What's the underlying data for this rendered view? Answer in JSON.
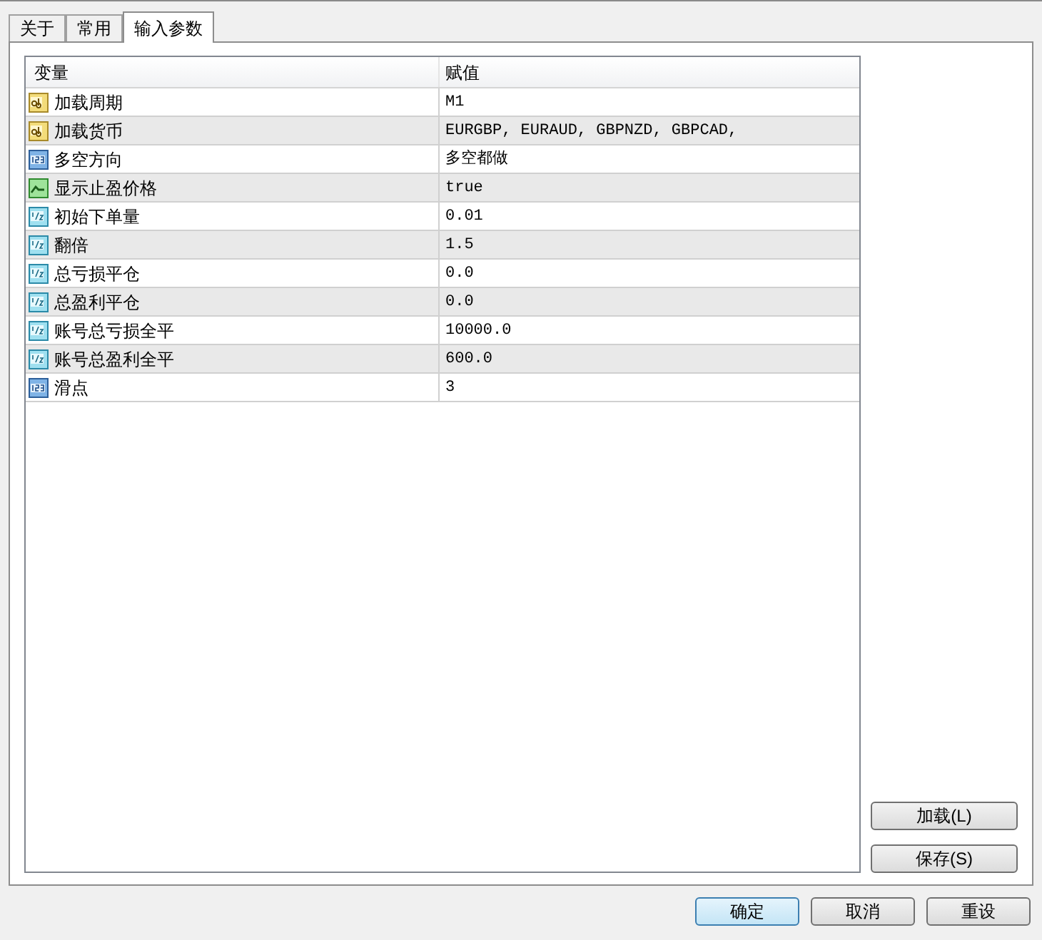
{
  "tabs": [
    {
      "label": "关于",
      "selected": false
    },
    {
      "label": "常用",
      "selected": false
    },
    {
      "label": "输入参数",
      "selected": true
    }
  ],
  "table": {
    "columns": [
      "变量",
      "赋值"
    ],
    "rows": [
      {
        "kind": "string",
        "name": "加载周期",
        "value": "M1"
      },
      {
        "kind": "string",
        "name": "加载货币",
        "value": "EURGBP, EURAUD, GBPNZD, GBPCAD,"
      },
      {
        "kind": "int",
        "name": "多空方向",
        "value": "多空都做"
      },
      {
        "kind": "bool",
        "name": "显示止盈价格",
        "value": "true"
      },
      {
        "kind": "double",
        "name": "初始下单量",
        "value": "0.01"
      },
      {
        "kind": "double",
        "name": "翻倍",
        "value": "1.5"
      },
      {
        "kind": "double",
        "name": "总亏损平仓",
        "value": "0.0"
      },
      {
        "kind": "double",
        "name": "总盈利平仓",
        "value": "0.0"
      },
      {
        "kind": "double",
        "name": "账号总亏损全平",
        "value": "10000.0"
      },
      {
        "kind": "double",
        "name": "账号总盈利全平",
        "value": "600.0"
      },
      {
        "kind": "int",
        "name": "滑点",
        "value": "3"
      }
    ]
  },
  "side_buttons": [
    "加载(L)",
    "保存(S)"
  ],
  "buttons": [
    {
      "label": "确定",
      "default": true
    },
    {
      "label": "取消",
      "default": false
    },
    {
      "label": "重设",
      "default": false
    }
  ]
}
